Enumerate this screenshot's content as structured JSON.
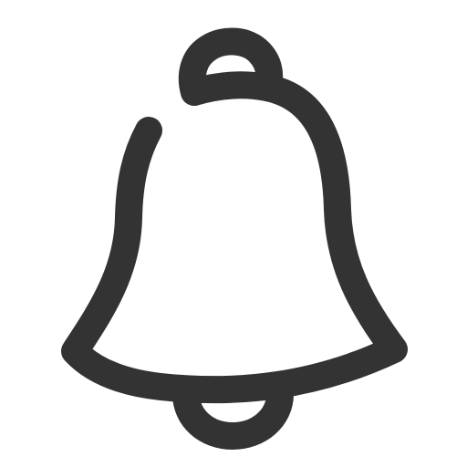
{
  "icon": {
    "name": "bell-icon",
    "stroke_color": "#333333",
    "background_color": "#ffffff"
  }
}
